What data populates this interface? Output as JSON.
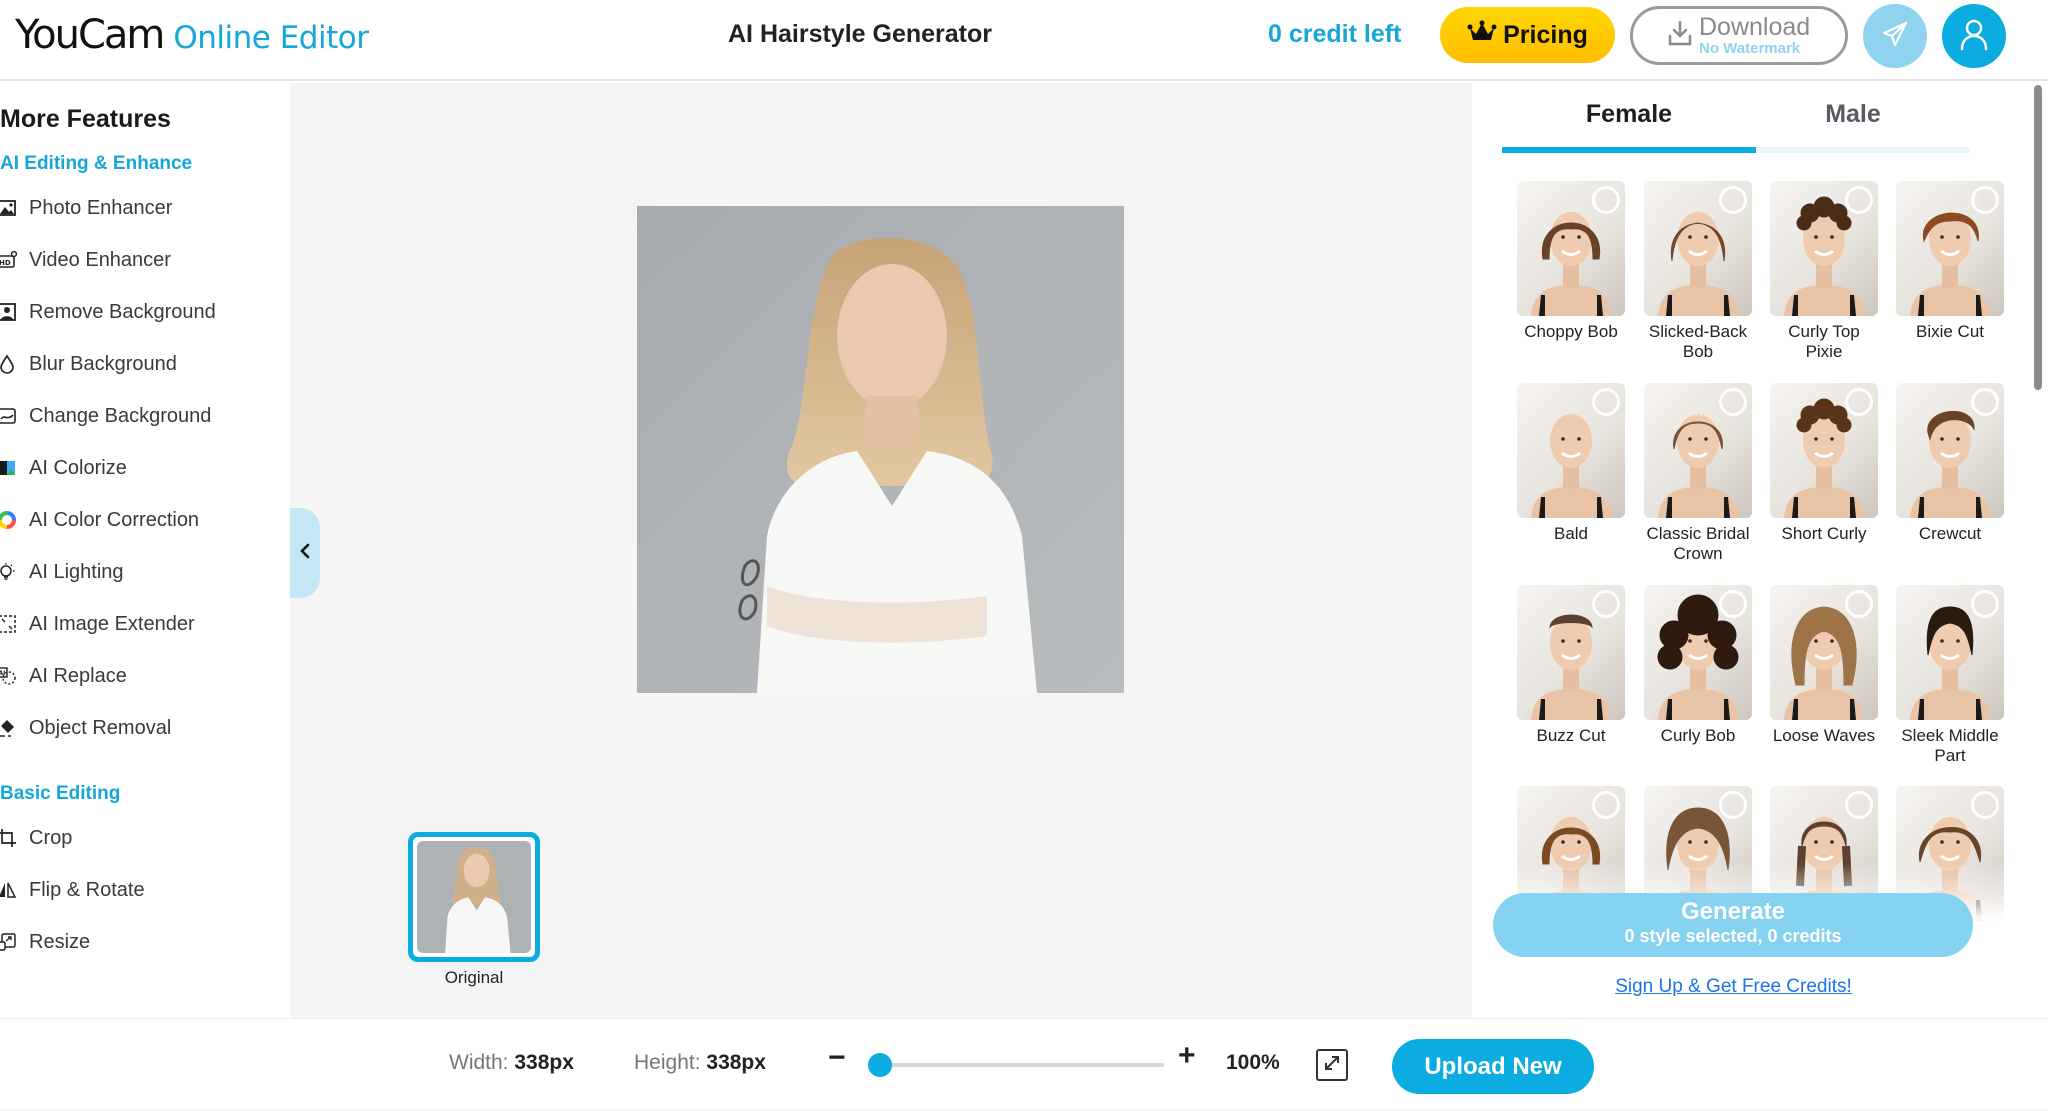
{
  "header": {
    "brand": "YouCam",
    "product": "Online Editor",
    "title": "AI Hairstyle Generator",
    "credits": "0 credit left",
    "pricing_label": "Pricing",
    "download_label": "Download",
    "download_sublabel": "No Watermark",
    "icons": {
      "pricing": "crown-icon",
      "download": "download-icon",
      "share": "paper-plane-icon",
      "profile": "user-icon"
    }
  },
  "sidebar": {
    "heading": "More Features",
    "sections": [
      {
        "label": "AI Editing & Enhance",
        "items": [
          {
            "label": "Photo Enhancer",
            "icon": "photo-enhance-icon"
          },
          {
            "label": "Video Enhancer",
            "icon": "hd-video-icon"
          },
          {
            "label": "Remove Background",
            "icon": "remove-background-icon"
          },
          {
            "label": "Blur Background",
            "icon": "droplet-icon"
          },
          {
            "label": "Change Background",
            "icon": "change-background-icon"
          },
          {
            "label": "AI Colorize",
            "icon": "colorize-icon"
          },
          {
            "label": "AI Color Correction",
            "icon": "color-wheel-icon"
          },
          {
            "label": "AI Lighting",
            "icon": "lightbulb-icon"
          },
          {
            "label": "AI Image Extender",
            "icon": "expand-icon"
          },
          {
            "label": "AI Replace",
            "icon": "ai-replace-icon"
          },
          {
            "label": "Object Removal",
            "icon": "eraser-icon"
          }
        ]
      },
      {
        "label": "Basic Editing",
        "items": [
          {
            "label": "Crop",
            "icon": "crop-icon"
          },
          {
            "label": "Flip & Rotate",
            "icon": "flip-icon"
          },
          {
            "label": "Resize",
            "icon": "resize-icon"
          }
        ]
      }
    ]
  },
  "canvas": {
    "collapse_icon": "chevron-left-icon",
    "thumbnail_label": "Original",
    "thumbnail_selected": true
  },
  "panel": {
    "tabs": [
      {
        "label": "Female",
        "active": true
      },
      {
        "label": "Male",
        "active": false
      }
    ],
    "styles": [
      {
        "name": "Choppy Bob",
        "hair": "#6b4228",
        "shape": "bob"
      },
      {
        "name": "Slicked-Back Bob",
        "hair": "#6e4a2e",
        "shape": "slick"
      },
      {
        "name": "Curly Top Pixie",
        "hair": "#4a2c18",
        "shape": "curlytop"
      },
      {
        "name": "Bixie Cut",
        "hair": "#8a4a22",
        "shape": "pixie"
      },
      {
        "name": "Bald",
        "hair": "#e2b99a",
        "shape": "bald"
      },
      {
        "name": "Classic Bridal Crown",
        "hair": "#7a5234",
        "shape": "crown"
      },
      {
        "name": "Short Curly",
        "hair": "#5a3418",
        "shape": "curlytop"
      },
      {
        "name": "Crewcut",
        "hair": "#6a4226",
        "shape": "crew"
      },
      {
        "name": "Buzz Cut",
        "hair": "#5a4030",
        "shape": "buzz"
      },
      {
        "name": "Curly Bob",
        "hair": "#2e1a0e",
        "shape": "curlybob"
      },
      {
        "name": "Loose Waves",
        "hair": "#9c7448",
        "shape": "long"
      },
      {
        "name": "Sleek Middle Part",
        "hair": "#2a1a10",
        "shape": "sleek"
      },
      {
        "name": "",
        "hair": "#7a4a22",
        "shape": "bob"
      },
      {
        "name": "",
        "hair": "#7a5638",
        "shape": "wavy"
      },
      {
        "name": "",
        "hair": "#5e4030",
        "shape": "braids"
      },
      {
        "name": "",
        "hair": "#6a4426",
        "shape": "shag"
      }
    ],
    "generate_label": "Generate",
    "generate_sublabel": "0 style selected, 0 credits",
    "signup_link": "Sign Up & Get Free Credits!"
  },
  "bottombar": {
    "width_label": "Width:",
    "width_value": "338px",
    "height_label": "Height:",
    "height_value": "338px",
    "zoom_minus": "−",
    "zoom_plus": "+",
    "zoom_value": "100%",
    "zoom_fraction": 0.0,
    "fit_icon": "fit-screen-icon",
    "upload_label": "Upload New"
  },
  "colors": {
    "accent": "#0bace0",
    "accent_light": "#86d3f1",
    "pricing": "#ffcc00",
    "link": "#1a73e8"
  }
}
